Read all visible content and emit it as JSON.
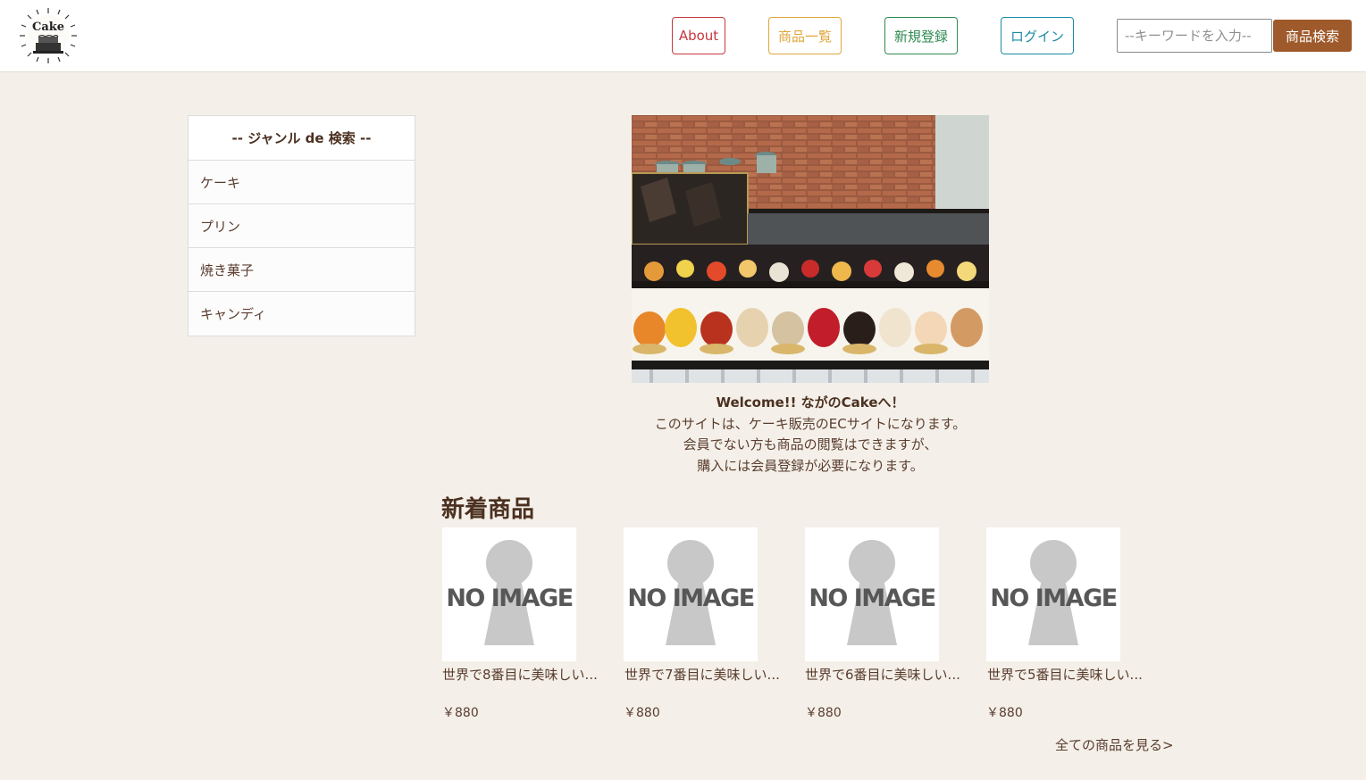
{
  "header": {
    "logo_alt": "Cake",
    "nav": {
      "about": "About",
      "products": "商品一覧",
      "register": "新規登録",
      "login": "ログイン"
    },
    "search": {
      "placeholder": "--キーワードを入力--",
      "value": "",
      "button": "商品検索"
    }
  },
  "sidebar": {
    "title": "-- ジャンル de 検索 --",
    "items": [
      {
        "label": "ケーキ"
      },
      {
        "label": "プリン"
      },
      {
        "label": "焼き菓子"
      },
      {
        "label": "キャンディ"
      }
    ]
  },
  "welcome": {
    "line1": "Welcome!! ながのCakeへ！",
    "line2": "このサイトは、ケーキ販売のECサイトになります。",
    "line3": "会員でない方も商品の閲覧はできますが、",
    "line4": "購入には会員登録が必要になります。"
  },
  "new_products": {
    "title": "新着商品",
    "no_image_text": "NO IMAGE",
    "items": [
      {
        "name": "世界で8番目に美味しい...",
        "price": "￥880"
      },
      {
        "name": "世界で7番目に美味しい...",
        "price": "￥880"
      },
      {
        "name": "世界で6番目に美味しい...",
        "price": "￥880"
      },
      {
        "name": "世界で5番目に美味しい...",
        "price": "￥880"
      }
    ],
    "all_link": "全ての商品を見る>"
  },
  "colors": {
    "background": "#f4f0e9",
    "about": "#c5383f",
    "products": "#e0a53a",
    "register": "#2e8a4f",
    "login": "#1c8aa3",
    "search_button": "#9e5a2b"
  }
}
